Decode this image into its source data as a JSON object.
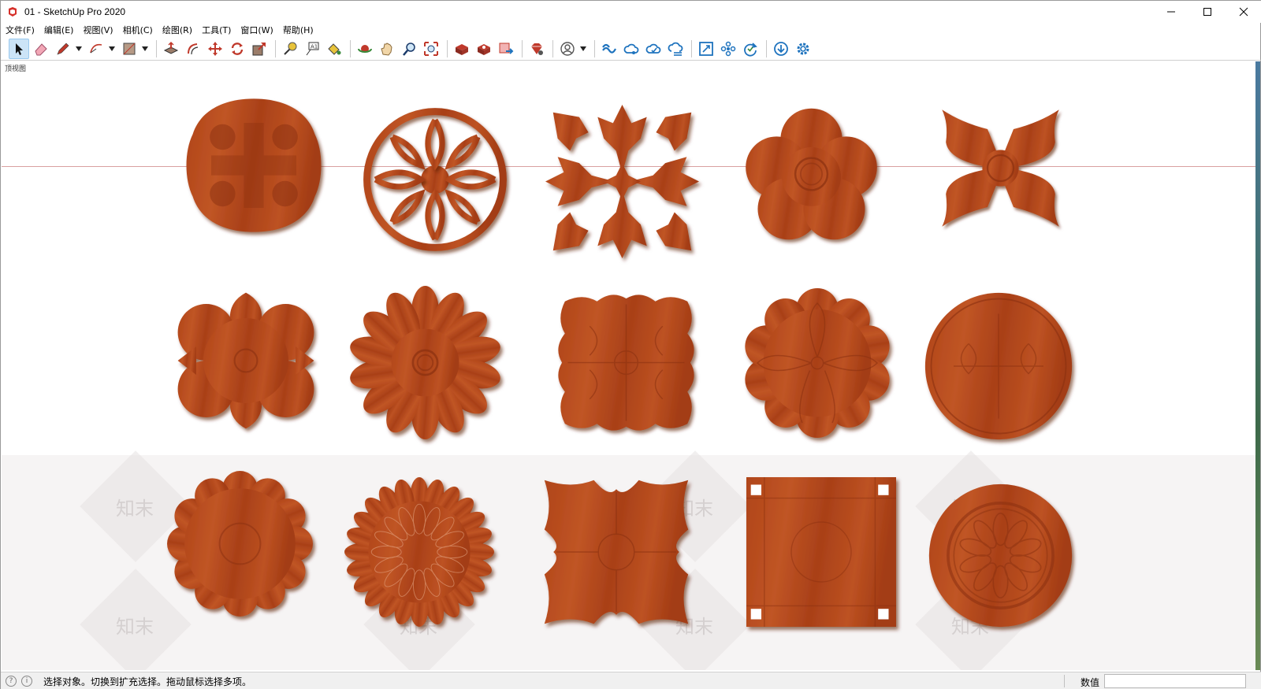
{
  "window": {
    "title": "01 - SketchUp Pro 2020",
    "controls": [
      "minimize",
      "maximize",
      "close"
    ]
  },
  "menu": [
    {
      "label": "文件(F)"
    },
    {
      "label": "编辑(E)"
    },
    {
      "label": "视图(V)"
    },
    {
      "label": "相机(C)"
    },
    {
      "label": "绘图(R)"
    },
    {
      "label": "工具(T)"
    },
    {
      "label": "窗口(W)"
    },
    {
      "label": "帮助(H)"
    }
  ],
  "toolbar": {
    "groups": [
      [
        "select-tool-icon",
        "eraser-tool-icon",
        "pencil-tool-icon",
        "arc-tool-icon",
        "rectangle-tool-icon"
      ],
      [
        "push-pull-icon",
        "offset-icon",
        "move-icon",
        "rotate-icon",
        "scale-icon"
      ],
      [
        "tape-measure-icon",
        "text-tool-icon",
        "paint-bucket-icon"
      ],
      [
        "orbit-icon",
        "pan-icon",
        "zoom-icon",
        "zoom-extents-icon"
      ],
      [
        "3d-warehouse-icon",
        "extension-warehouse-icon",
        "layout-send-icon"
      ],
      [
        "extension-manager-icon"
      ],
      [
        "account-icon"
      ],
      [
        "trimble-connect-icon",
        "share-model-icon",
        "cloud-upload-icon",
        "cloud-sync-icon"
      ],
      [
        "fullscreen-icon",
        "components-icon",
        "refresh-icon"
      ],
      [
        "download-icon",
        "settings-icon"
      ]
    ],
    "accent_color": "#1e73be"
  },
  "canvas": {
    "scene_label": "顶视图",
    "watermark_text": "知末",
    "wood_color": "#b5481e"
  },
  "carvings": [
    {
      "name": "cross-quatrefoil-carving"
    },
    {
      "name": "round-lattice-carving"
    },
    {
      "name": "square-leaf-carving"
    },
    {
      "name": "five-petal-flower-carving"
    },
    {
      "name": "four-petal-cross-carving"
    },
    {
      "name": "six-petal-flower-carving"
    },
    {
      "name": "daisy-carving"
    },
    {
      "name": "square-acanthus-carving"
    },
    {
      "name": "scroll-rosette-carving"
    },
    {
      "name": "round-medallion-carving"
    },
    {
      "name": "scalloped-round-carving"
    },
    {
      "name": "chrysanthemum-carving"
    },
    {
      "name": "square-scallop-carving"
    },
    {
      "name": "square-panel-carving"
    },
    {
      "name": "round-rosette-plate-carving"
    }
  ],
  "status": {
    "message": "选择对象。切换到扩充选择。拖动鼠标选择多项。",
    "value_label": "数值",
    "value": ""
  }
}
